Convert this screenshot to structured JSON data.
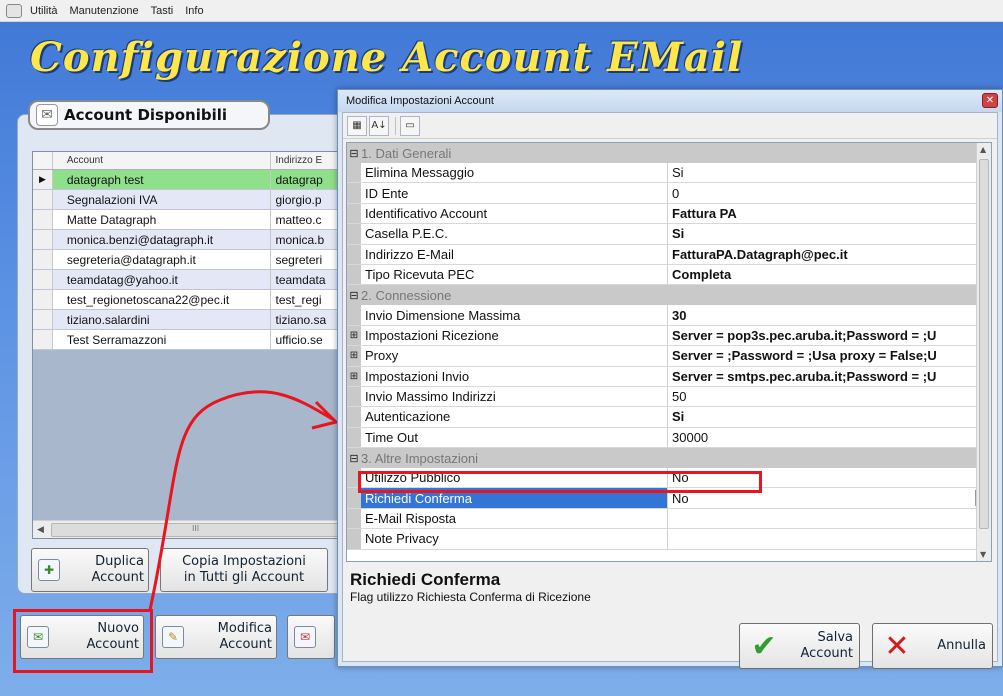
{
  "menu": {
    "items": [
      "Utilità",
      "Manutenzione",
      "Tasti",
      "Info"
    ]
  },
  "main": {
    "title": "Configurazione Account EMail",
    "accounts_header": "Account Disponibili",
    "grid": {
      "columns": [
        "Account",
        "Indirizzo E"
      ],
      "rows": [
        {
          "account": "datagraph test",
          "address": "datagrap"
        },
        {
          "account": "Segnalazioni IVA",
          "address": "giorgio.p"
        },
        {
          "account": "Matte Datagraph",
          "address": "matteo.c"
        },
        {
          "account": "monica.benzi@datagraph.it",
          "address": "monica.b"
        },
        {
          "account": "segreteria@datagraph.it",
          "address": "segreteri"
        },
        {
          "account": "teamdatag@yahoo.it",
          "address": "teamdata"
        },
        {
          "account": "test_regionetoscana22@pec.it",
          "address": "test_regi"
        },
        {
          "account": "tiziano.salardini",
          "address": "tiziano.sa"
        },
        {
          "account": "Test Serramazzoni",
          "address": "ufficio.se"
        }
      ],
      "scroll_label": "III"
    },
    "buttons": {
      "duplica": "Duplica\nAccount",
      "copia": "Copia Impostazioni\nin Tutti gli Account",
      "nuovo": "Nuovo\nAccount",
      "modifica": "Modifica\nAccount"
    }
  },
  "dialog": {
    "title": "Modifica Impostazioni Account",
    "categories": {
      "c1": "1. Dati Generali",
      "c2": "2. Connessione",
      "c3": "3. Altre Impostazioni"
    },
    "props1": [
      {
        "name": "Elimina Messaggio",
        "value": "Si",
        "bold": false
      },
      {
        "name": "ID Ente",
        "value": "0",
        "bold": false
      },
      {
        "name": "Identificativo Account",
        "value": "Fattura PA",
        "bold": true
      },
      {
        "name": "Casella P.E.C.",
        "value": "Si",
        "bold": true
      },
      {
        "name": "Indirizzo E-Mail",
        "value": "FatturaPA.Datagraph@pec.it",
        "bold": true
      },
      {
        "name": "Tipo Ricevuta PEC",
        "value": "Completa",
        "bold": true
      }
    ],
    "props2": [
      {
        "name": "Invio Dimensione Massima",
        "value": "30",
        "bold": true
      },
      {
        "name": "Impostazioni Ricezione",
        "value": "Server = pop3s.pec.aruba.it;Password = ;U",
        "bold": true
      },
      {
        "name": "Proxy",
        "value": "Server = ;Password = ;Usa proxy = False;U",
        "bold": true
      },
      {
        "name": "Impostazioni Invio",
        "value": "Server = smtps.pec.aruba.it;Password = ;U",
        "bold": true
      },
      {
        "name": "Invio Massimo Indirizzi",
        "value": "50",
        "bold": false
      },
      {
        "name": "Autenticazione",
        "value": "Si",
        "bold": true
      },
      {
        "name": "Time Out",
        "value": "30000",
        "bold": false
      }
    ],
    "props3": [
      {
        "name": "Utilizzo Pubblico",
        "value": "No",
        "bold": false
      },
      {
        "name": "Richiedi Conferma",
        "value": "No",
        "bold": false
      },
      {
        "name": "E-Mail Risposta",
        "value": "",
        "bold": false
      },
      {
        "name": "Note Privacy",
        "value": "",
        "bold": false
      }
    ],
    "help": {
      "title": "Richiedi Conferma",
      "description": "Flag utilizzo Richiesta Conferma di Ricezione"
    },
    "buttons": {
      "salva": "Salva\nAccount",
      "annulla": "Annulla"
    }
  },
  "colors": {
    "title_yellow": "#ffe64a",
    "highlight_red": "#e8141e",
    "selected_green": "#8fe08a",
    "selection_blue": "#3375d6"
  }
}
